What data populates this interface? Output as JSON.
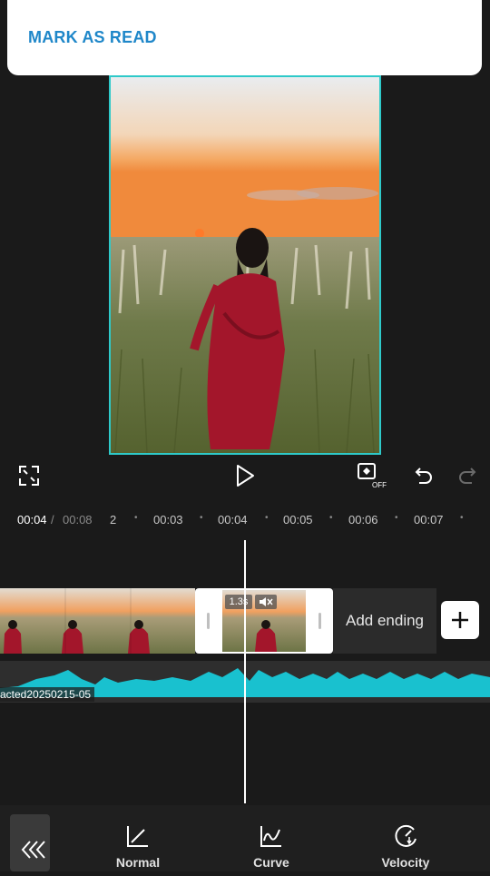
{
  "notification": {
    "action_label": "MARK AS READ"
  },
  "player": {
    "fullscreen_icon": "fullscreen-icon",
    "play_icon": "play-icon",
    "keyframe_off_icon": "keyframe-off-icon",
    "undo_icon": "undo-icon",
    "redo_icon": "redo-icon"
  },
  "timeline": {
    "current_time": "00:04",
    "separator": "/",
    "total_time": "00:08",
    "ticks": [
      "2",
      "00:03",
      "00:04",
      "00:05",
      "00:06",
      "00:07"
    ]
  },
  "clips": {
    "selected_speed": "1.3s",
    "add_ending_label": "Add ending",
    "add_icon": "plus-icon"
  },
  "audio": {
    "label": "acted20250215-05"
  },
  "toolbar": {
    "back_icon": "double-chevron-left-icon",
    "tools": [
      {
        "label": "Normal",
        "icon": "normal-speed-icon"
      },
      {
        "label": "Curve",
        "icon": "curve-speed-icon"
      },
      {
        "label": "Velocity",
        "icon": "velocity-icon"
      }
    ]
  },
  "colors": {
    "accent": "#2ec9c9",
    "link": "#1f87c9",
    "background": "#1a1a1a"
  }
}
